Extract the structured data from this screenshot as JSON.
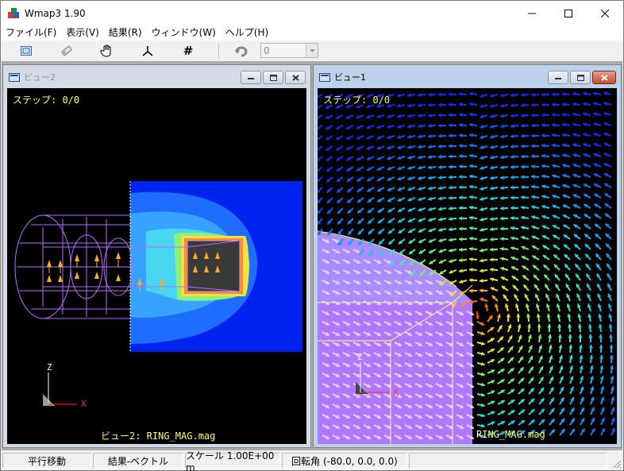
{
  "window": {
    "title": "Wmap3 1.90",
    "colors": {
      "accent": "#0078d7",
      "viewport_bg": "#000000",
      "label": "#ffff55"
    }
  },
  "menu": [
    {
      "label": "ファイル(F)"
    },
    {
      "label": "表示(V)"
    },
    {
      "label": "結果(R)"
    },
    {
      "label": "ウィンドウ(W)"
    },
    {
      "label": "ヘルプ(H)"
    }
  ],
  "toolbar": {
    "icons": [
      "frame-icon",
      "eraser-icon",
      "hand-pan-icon",
      "axes-icon",
      "grid-hash-icon",
      "rotate-icon"
    ],
    "hash_glyph": "#",
    "step_value": "0"
  },
  "view2": {
    "title": "ビュー2",
    "step_label": "ステップ: 0/0",
    "caption": "ビュー2: RING_MAG.mag",
    "axes": {
      "z": "Z",
      "x": "X"
    }
  },
  "view1": {
    "title": "ビュー1",
    "step_label": "ステップ: 0/0",
    "caption": "RING_MAG.mag",
    "axes": {
      "z": "Z",
      "x": "X"
    }
  },
  "status": {
    "mode": "平行移動",
    "result": "結果-ベクトル",
    "scale": "スケール 1.00E+00 m",
    "rotation": "回転角 (-80.0, 0.0, 0.0)"
  }
}
